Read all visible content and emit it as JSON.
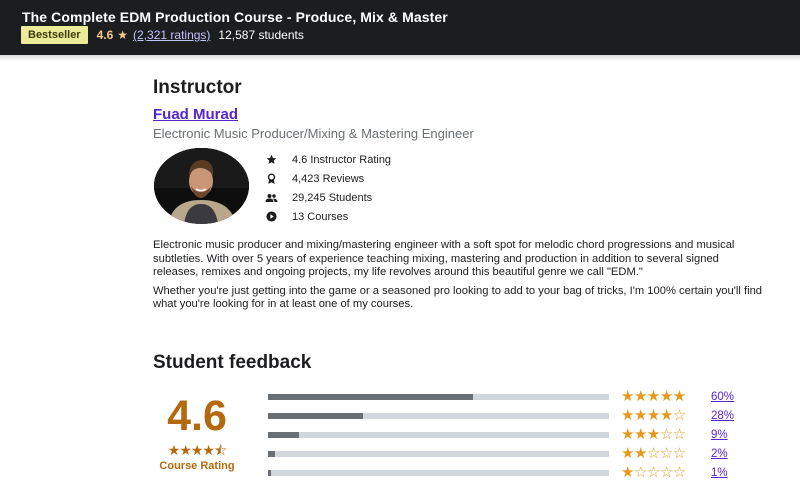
{
  "header": {
    "course_title": "The Complete EDM Production Course - Produce, Mix & Master",
    "badge": "Bestseller",
    "rating": "4.6",
    "ratings_count": "(2,321 ratings)",
    "students": "12,587 students"
  },
  "instructor": {
    "heading": "Instructor",
    "name": "Fuad Murad",
    "job_title": "Electronic Music Producer/Mixing & Mastering Engineer",
    "stats": [
      {
        "icon": "star-icon",
        "text": "4.6 Instructor Rating"
      },
      {
        "icon": "award-icon",
        "text": "4,423 Reviews"
      },
      {
        "icon": "users-icon",
        "text": "29,245 Students"
      },
      {
        "icon": "play-icon",
        "text": "13 Courses"
      }
    ],
    "bio": [
      "Electronic music producer and mixing/mastering engineer with a soft spot for melodic chord progressions and musical subtleties.  With over 5 years of experience teaching mixing, mastering and production in addition to several signed releases, remixes and ongoing projects, my life revolves around this beautiful genre we call \"EDM.\"",
      "Whether you're just getting into the game or a seasoned pro looking to add to your bag of tricks, I'm 100% certain you'll find what you're looking for in at least one of my courses."
    ]
  },
  "feedback": {
    "heading": "Student feedback",
    "rating": "4.6",
    "rating_stars": "★★★★⯪",
    "rating_label": "Course Rating",
    "rows": [
      {
        "stars": 5,
        "percent": 60,
        "label": "60%"
      },
      {
        "stars": 4,
        "percent": 28,
        "label": "28%"
      },
      {
        "stars": 3,
        "percent": 9,
        "label": "9%"
      },
      {
        "stars": 2,
        "percent": 2,
        "label": "2%"
      },
      {
        "stars": 1,
        "percent": 1,
        "label": "1%"
      }
    ]
  },
  "colors": {
    "header_bg": "#1c1d1f",
    "accent_purple": "#5624d0",
    "rating_orange": "#b4690e",
    "star_orange": "#e59819"
  }
}
